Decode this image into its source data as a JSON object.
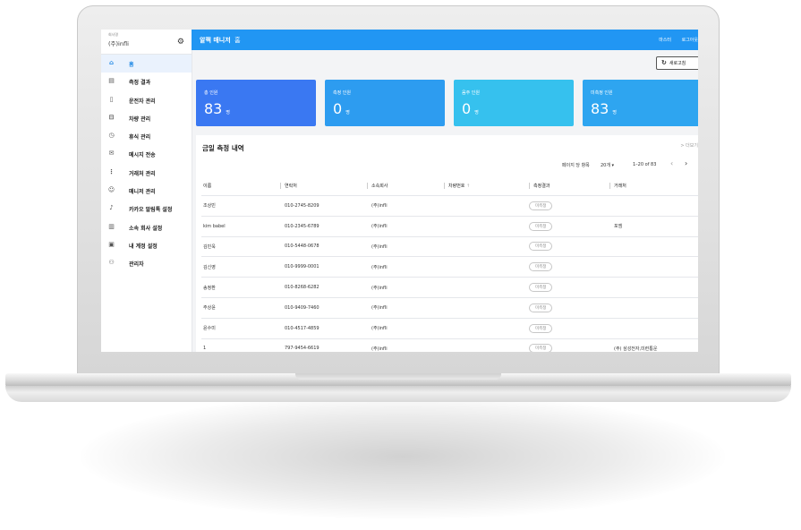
{
  "sidebar": {
    "company_label": "회사명",
    "company_name": "(주)infli",
    "settings_icon": "gear-icon",
    "items": [
      {
        "label": "홈",
        "icon": "home-icon",
        "active": true
      },
      {
        "label": "측정 결과",
        "icon": "chart-icon"
      },
      {
        "label": "운전자 관리",
        "icon": "id-card-icon"
      },
      {
        "label": "차량 관리",
        "icon": "car-icon"
      },
      {
        "label": "휴식 관리",
        "icon": "clock-icon"
      },
      {
        "label": "메시지 전송",
        "icon": "mail-icon"
      },
      {
        "label": "거래처 관리",
        "icon": "network-icon"
      },
      {
        "label": "매니저 관리",
        "icon": "manager-icon"
      },
      {
        "label": "카카오 알림톡 설정",
        "icon": "bell-icon"
      },
      {
        "label": "소속 회사 설정",
        "icon": "building-icon"
      },
      {
        "label": "내 계정 설정",
        "icon": "account-icon"
      },
      {
        "label": "관리자",
        "icon": "admin-icon"
      }
    ]
  },
  "header": {
    "title": "알쩍 매니저",
    "home_label": "홈",
    "user": "마스터",
    "logout": "로그아웃"
  },
  "refresh_label": "새로고침",
  "stats": [
    {
      "label": "총 인원",
      "value": "83",
      "unit": "명",
      "color": "#3a78f2"
    },
    {
      "label": "측정 인원",
      "value": "0",
      "unit": "명",
      "color": "#2d9cf0"
    },
    {
      "label": "음주 인원",
      "value": "0",
      "unit": "명",
      "color": "#36c1ee"
    },
    {
      "label": "미측정 인원",
      "value": "83",
      "unit": "명",
      "color": "#2ea5f0"
    }
  ],
  "table": {
    "title": "금일 측정 내역",
    "more": "> 더보기",
    "rows_per_page_label": "페이지 당 항목",
    "rows_per_page": "20개",
    "range": "1–20 of 83",
    "columns": [
      "이름",
      "연락처",
      "소속회사",
      "차량번호",
      "측정결과",
      "거래처"
    ],
    "rows": [
      [
        "조상빈",
        "010-2745-8209",
        "(주)infli",
        "",
        "미측정",
        ""
      ],
      [
        "kim babel",
        "010-2345-6789",
        "(주)infli",
        "",
        "미측정",
        "포엠"
      ],
      [
        "김민욱",
        "010-5448-0678",
        "(주)infli",
        "",
        "미측정",
        ""
      ],
      [
        "김신영",
        "010-9999-0001",
        "(주)infli",
        "",
        "미측정",
        ""
      ],
      [
        "송정환",
        "010-8268-6282",
        "(주)infli",
        "",
        "미측정",
        ""
      ],
      [
        "주상윤",
        "010-9409-7460",
        "(주)infli",
        "",
        "미측정",
        ""
      ],
      [
        "윤수미",
        "010-4517-4859",
        "(주)infli",
        "",
        "미측정",
        ""
      ],
      [
        "1",
        "797-9454-6619",
        "(주)infli",
        "",
        "미측정",
        "(주) 삼성전자,미련통운"
      ]
    ]
  }
}
